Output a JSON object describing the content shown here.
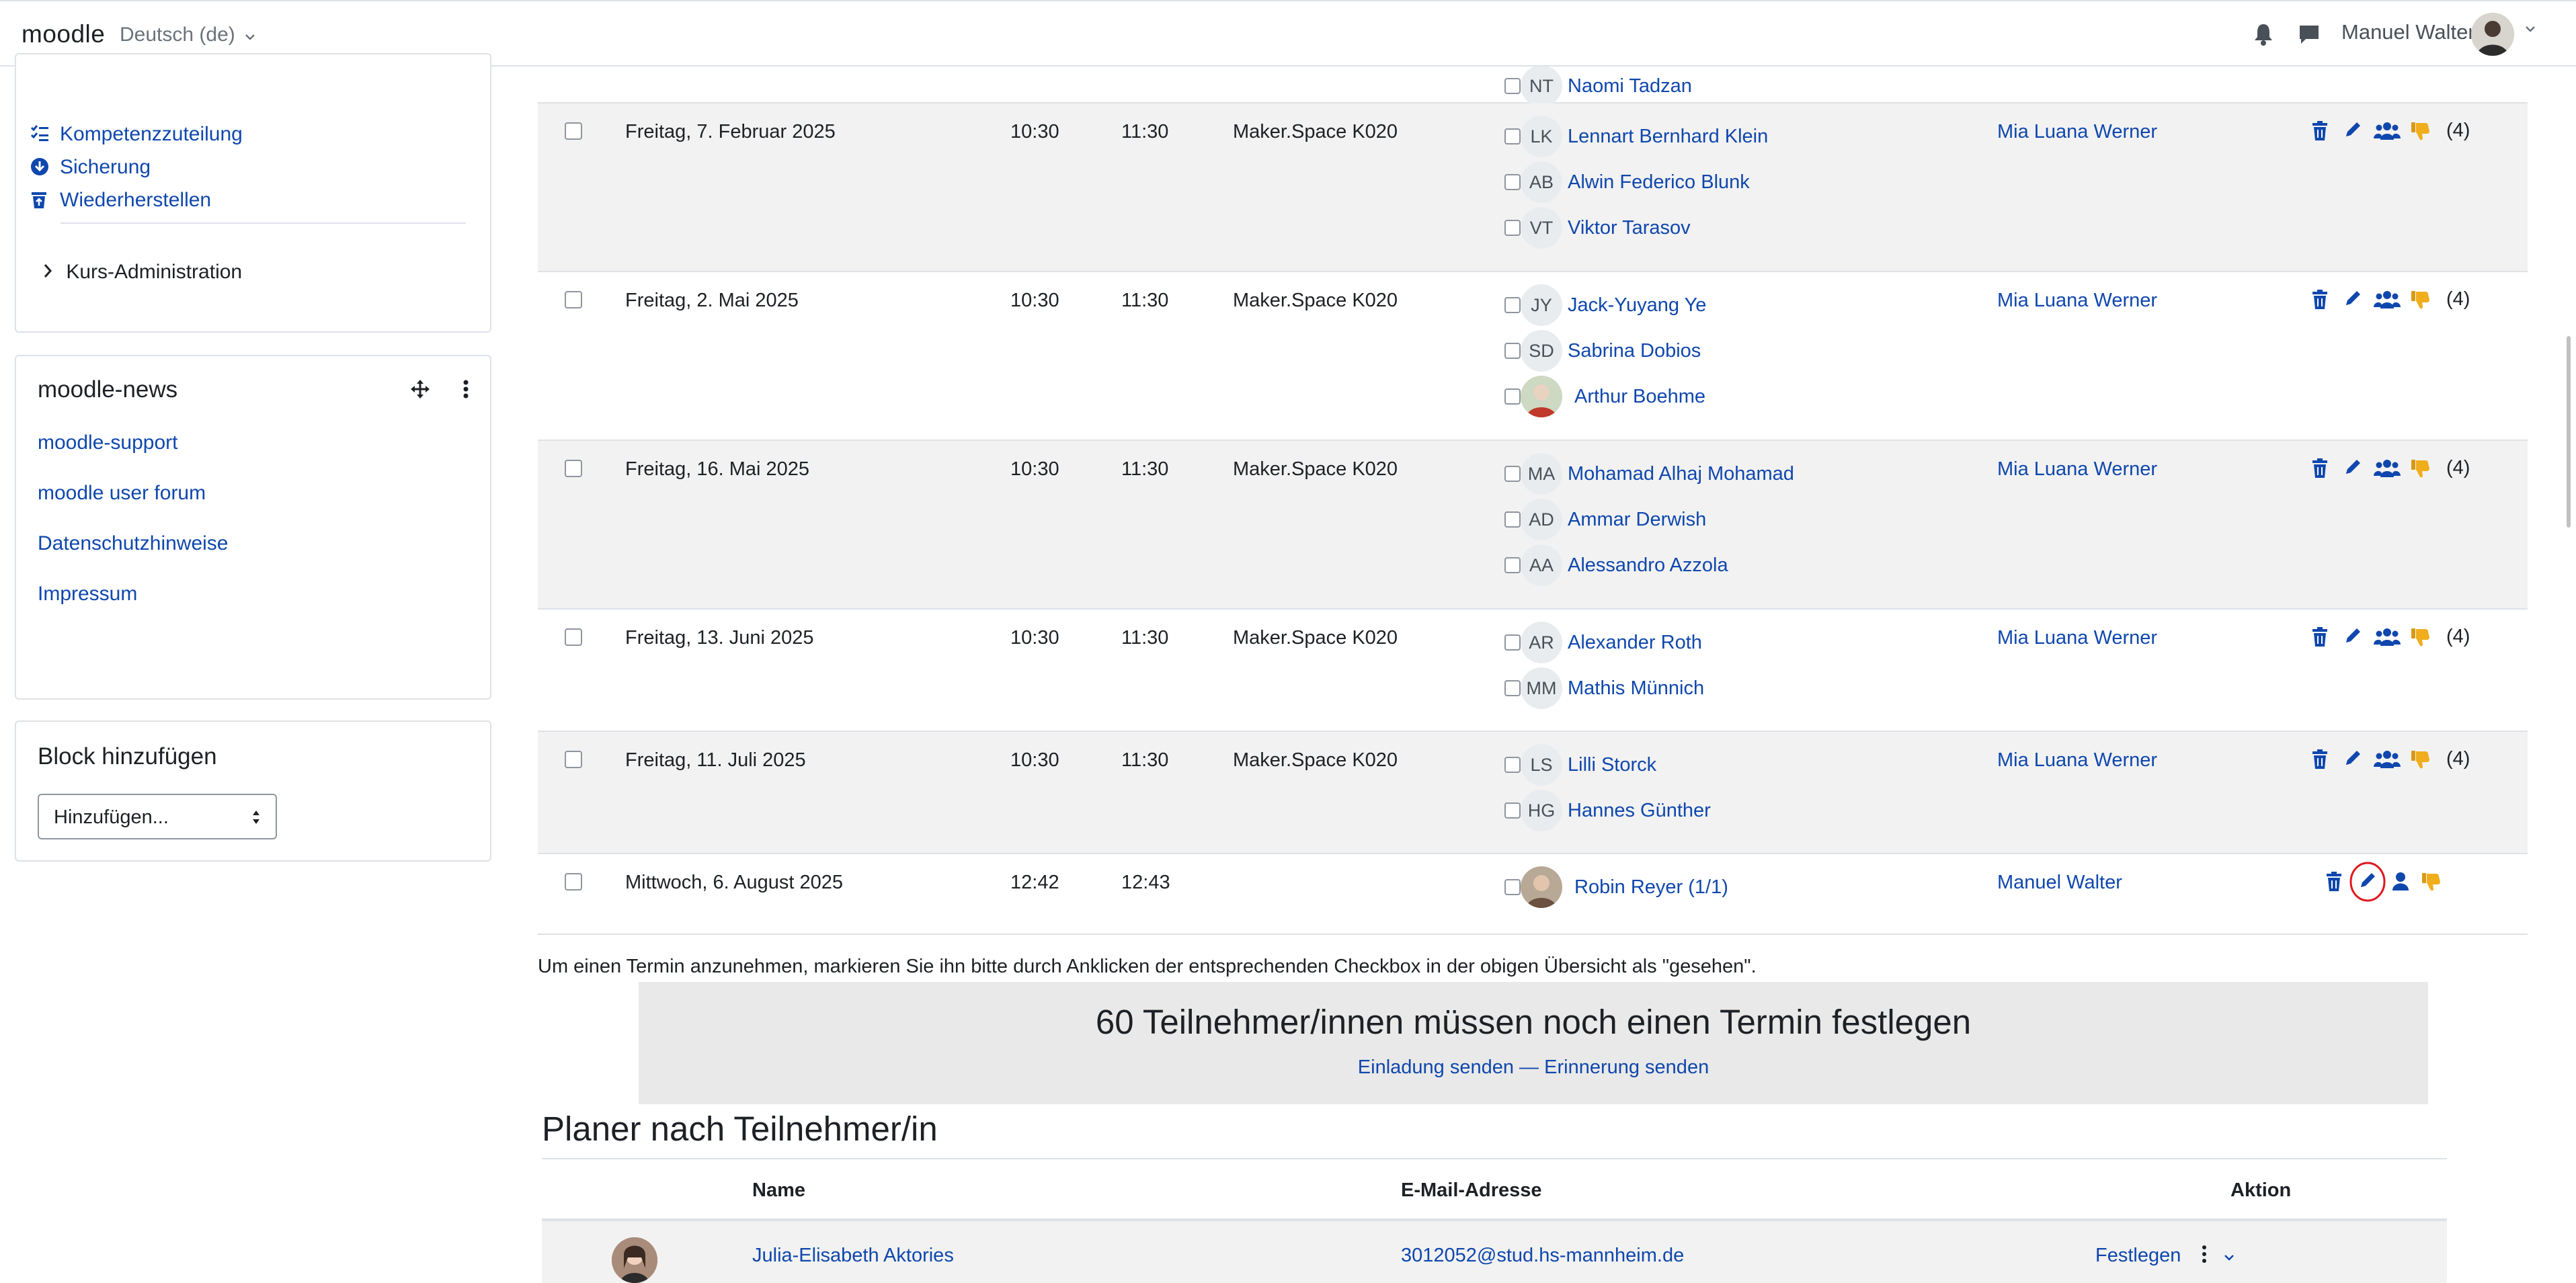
{
  "navbar": {
    "brand": "moodle",
    "language": "Deutsch (de)",
    "user_name": "Manuel Walter"
  },
  "sidebar": {
    "admin_items": [
      {
        "label": "Kompetenzzuteilung",
        "icon": "list-check-icon"
      },
      {
        "label": "Sicherung",
        "icon": "download-circle-icon"
      },
      {
        "label": "Wiederherstellen",
        "icon": "trash-restore-icon"
      }
    ],
    "course_admin": "Kurs-Administration",
    "news_block": {
      "title": "moodle-news",
      "links": [
        "moodle-support",
        "moodle user forum",
        "Datenschutzhinweise",
        "Impressum"
      ]
    },
    "add_block": {
      "title": "Block hinzufügen",
      "select_value": "Hinzufügen..."
    }
  },
  "slots": [
    {
      "partial": true,
      "participants": [
        {
          "initials": "NT",
          "name": "Naomi Tadzan"
        }
      ]
    },
    {
      "date": "Freitag, 7. Februar 2025",
      "start": "10:30",
      "end": "11:30",
      "location": "Maker.Space K020",
      "teacher": "Mia Luana Werner",
      "count": "(4)",
      "participants": [
        {
          "initials": "LK",
          "name": "Lennart Bernhard Klein"
        },
        {
          "initials": "AB",
          "name": "Alwin Federico Blunk"
        },
        {
          "initials": "VT",
          "name": "Viktor Tarasov"
        }
      ]
    },
    {
      "date": "Freitag, 2. Mai 2025",
      "start": "10:30",
      "end": "11:30",
      "location": "Maker.Space K020",
      "teacher": "Mia Luana Werner",
      "count": "(4)",
      "participants": [
        {
          "initials": "JY",
          "name": "Jack-Yuyang Ye"
        },
        {
          "initials": "SD",
          "name": "Sabrina Dobios"
        },
        {
          "initials": "",
          "name": "Arthur Boehme",
          "photo": true
        }
      ]
    },
    {
      "date": "Freitag, 16. Mai 2025",
      "start": "10:30",
      "end": "11:30",
      "location": "Maker.Space K020",
      "teacher": "Mia Luana Werner",
      "count": "(4)",
      "participants": [
        {
          "initials": "MA",
          "name": "Mohamad Alhaj Mohamad"
        },
        {
          "initials": "AD",
          "name": "Ammar Derwish"
        },
        {
          "initials": "AA",
          "name": "Alessandro Azzola"
        }
      ]
    },
    {
      "date": "Freitag, 13. Juni 2025",
      "start": "10:30",
      "end": "11:30",
      "location": "Maker.Space K020",
      "teacher": "Mia Luana Werner",
      "count": "(4)",
      "participants": [
        {
          "initials": "AR",
          "name": "Alexander Roth"
        },
        {
          "initials": "MM",
          "name": "Mathis Münnich"
        }
      ]
    },
    {
      "date": "Freitag, 11. Juli 2025",
      "start": "10:30",
      "end": "11:30",
      "location": "Maker.Space K020",
      "teacher": "Mia Luana Werner",
      "count": "(4)",
      "participants": [
        {
          "initials": "LS",
          "name": "Lilli Storck"
        },
        {
          "initials": "HG",
          "name": "Hannes Günther"
        }
      ]
    },
    {
      "date": "Mittwoch, 6. August 2025",
      "start": "12:42",
      "end": "12:43",
      "location": "",
      "teacher": "Manuel Walter",
      "count": "",
      "participants": [
        {
          "initials": "",
          "name": "Robin Reyer (1/1)",
          "photo": true
        }
      ]
    }
  ],
  "note": "Um einen Termin anzunehmen, markieren Sie ihn bitte durch Anklicken der entsprechenden Checkbox in der obigen Übersicht als \"gesehen\".",
  "banner": {
    "title": "60 Teilnehmer/innen müssen noch einen Termin festlegen",
    "invite": "Einladung senden",
    "separator": " — ",
    "reminder": "Erinnerung senden"
  },
  "planner": {
    "title": "Planer nach Teilnehmer/in",
    "headers": {
      "name": "Name",
      "email": "E-Mail-Adresse",
      "action": "Aktion"
    },
    "rows": [
      {
        "name": "Julia-Elisabeth Aktories",
        "email": "3012052@stud.hs-mannheim.de",
        "action": "Festlegen"
      }
    ]
  },
  "colors": {
    "link": "#0f47ad",
    "dislike": "#f0ad1c",
    "highlight": "#e0171f"
  }
}
